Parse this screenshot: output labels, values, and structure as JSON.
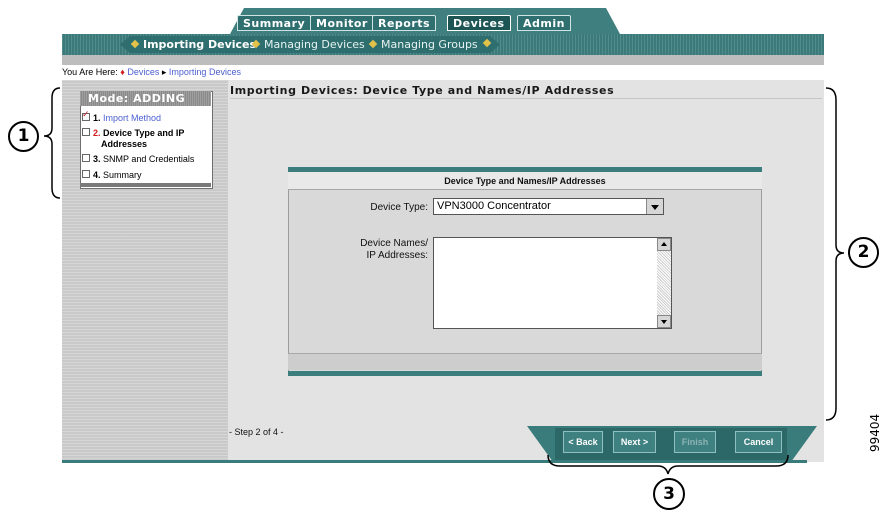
{
  "tabs": [
    {
      "label": "Summary",
      "active": false
    },
    {
      "label": "Monitor",
      "active": false
    },
    {
      "label": "Reports",
      "active": false
    },
    {
      "label": "Devices",
      "active": true
    },
    {
      "label": "Admin",
      "active": false
    }
  ],
  "subnav": [
    {
      "label": "Importing Devices",
      "active": true
    },
    {
      "label": "Managing Devices",
      "active": false
    },
    {
      "label": "Managing Groups",
      "active": false
    }
  ],
  "breadcrumb": {
    "prefix": "You Are Here:",
    "items": [
      "Devices",
      "Importing Devices"
    ]
  },
  "left_panel": {
    "mode_title": "Mode: ADDING",
    "steps": [
      {
        "number": "1.",
        "label": "Import Method"
      },
      {
        "number": "2.",
        "label": "Device Type and IP",
        "label2": "Addresses"
      },
      {
        "number": "3.",
        "label": "SNMP and Credentials"
      },
      {
        "number": "4.",
        "label": "Summary"
      }
    ]
  },
  "page_title": "Importing Devices: Device Type and Names/IP Addresses",
  "form": {
    "title": "Device Type and Names/IP Addresses",
    "device_type_label": "Device Type:",
    "device_type_value": "VPN3000 Concentrator",
    "names_label_1": "Device Names/",
    "names_label_2": "IP Addresses:",
    "names_value": ""
  },
  "footer": {
    "step_text": "- Step 2 of 4 -",
    "buttons": {
      "back": "< Back",
      "next": "Next >",
      "finish": "Finish",
      "cancel": "Cancel"
    }
  },
  "callouts": [
    "1",
    "2",
    "3"
  ],
  "figure_number": "99404",
  "colors": {
    "teal": "#3a7b7b",
    "link": "#4a5fd0",
    "current_step": "#d41c1c"
  },
  "icons": [
    "checkbox-checked-icon",
    "checkbox-icon",
    "dropdown-arrow-icon",
    "scroll-up-icon",
    "scroll-down-icon",
    "diamond-bullet-icon"
  ]
}
